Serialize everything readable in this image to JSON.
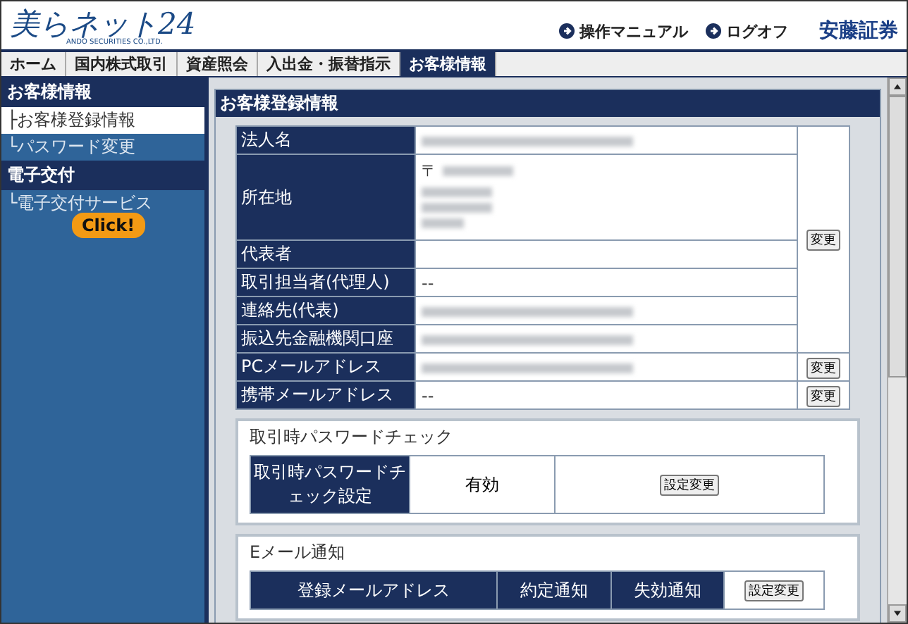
{
  "header": {
    "logo": "美らネット24",
    "logo_subtitle": "ANDO SECURITIES CO.,LTD.",
    "links": [
      "操作マニュアル",
      "ログオフ"
    ],
    "brand": "安藤証券"
  },
  "tabs": [
    {
      "label": "ホーム",
      "selected": false
    },
    {
      "label": "国内株式取引",
      "selected": false
    },
    {
      "label": "資産照会",
      "selected": false
    },
    {
      "label": "入出金・振替指示",
      "selected": false
    },
    {
      "label": "お客様情報",
      "selected": true
    }
  ],
  "sidebar": {
    "sections": [
      {
        "title": "お客様情報",
        "items": [
          {
            "label": "├お客様登録情報",
            "selected": true
          },
          {
            "label": "└パスワード変更",
            "selected": false
          }
        ]
      },
      {
        "title": "電子交付",
        "items": [
          {
            "label": "└電子交付サービス",
            "selected": false
          }
        ]
      }
    ],
    "callout": "Click!"
  },
  "panel": {
    "title": "お客様登録情報",
    "groups": [
      {
        "button": "変更",
        "rows": [
          {
            "label": "法人名",
            "kind": "redacted"
          },
          {
            "label": "所在地",
            "kind": "address",
            "value": "〒"
          },
          {
            "label": "代表者",
            "kind": "text"
          },
          {
            "label": "取引担当者(代理人)",
            "kind": "text",
            "value": "--"
          },
          {
            "label": "連絡先(代表)",
            "kind": "redacted"
          },
          {
            "label": "振込先金融機関口座",
            "kind": "redacted"
          }
        ]
      },
      {
        "button": "変更",
        "rows": [
          {
            "label": "PCメールアドレス",
            "kind": "redacted"
          }
        ]
      },
      {
        "button": "変更",
        "rows": [
          {
            "label": "携帯メールアドレス",
            "kind": "text",
            "value": "--"
          }
        ]
      }
    ],
    "password_check": {
      "title": "取引時パスワードチェック",
      "label": "取引時パスワードチェック設定",
      "value": "有効",
      "button": "設定変更"
    },
    "email": {
      "title": "Eメール通知",
      "columns": [
        "登録メールアドレス",
        "約定通知",
        "失効通知"
      ],
      "button": "設定変更"
    }
  }
}
